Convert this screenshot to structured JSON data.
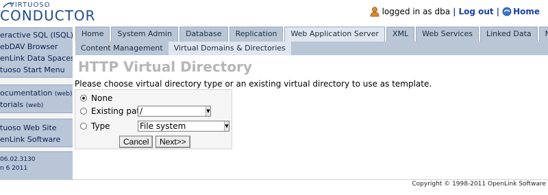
{
  "app": {
    "logo_top": "VIRTUOSO",
    "logo_main": "CONDUCTOR"
  },
  "userbar": {
    "user_icon": "user-icon",
    "logged_in_text": "logged in as dba",
    "separator": "|",
    "logout_label": "Log out",
    "home_icon": "home-icon",
    "home_label": "Home"
  },
  "sidebar": {
    "groups": [
      {
        "items": [
          {
            "text": "eractive SQL (ISQL)"
          },
          {
            "text": "ebDAV Browser"
          },
          {
            "text": "enLink Data Spaces"
          },
          {
            "text": "tuoso Start Menu"
          }
        ]
      },
      {
        "items": [
          {
            "text": "ocumentation",
            "small": "(web)"
          },
          {
            "text": "torials",
            "small": "(web)"
          }
        ]
      },
      {
        "items": [
          {
            "text": "tuoso Web Site"
          },
          {
            "text": "enLink Software"
          }
        ]
      },
      {
        "items": [
          {
            "text": " 06.02.3130"
          },
          {
            "text": "n 6 2011"
          }
        ]
      }
    ]
  },
  "tabs": [
    {
      "label": "Home",
      "active": false
    },
    {
      "label": "System Admin",
      "active": false
    },
    {
      "label": "Database",
      "active": false
    },
    {
      "label": "Replication",
      "active": false
    },
    {
      "label": "Web Application Server",
      "active": true
    },
    {
      "label": "XML",
      "active": false
    },
    {
      "label": "Web Services",
      "active": false
    },
    {
      "label": "Linked Data",
      "active": false
    },
    {
      "label": "NNTP",
      "active": false
    }
  ],
  "subtabs": [
    {
      "label": "Content Management",
      "active": false
    },
    {
      "label": "Virtual Domains & Directories",
      "active": true
    }
  ],
  "page_title": "HTTP Virtual Directory",
  "prompt": "Please choose virtual directory type or an existing virtual directory to use as template.",
  "form": {
    "option_none": "None",
    "option_existing": "Existing path",
    "option_type": "Type",
    "selected": "none",
    "existing_path_value": "/",
    "type_value": "File system",
    "cancel_label": "Cancel",
    "next_label": "Next>>"
  },
  "footer": "Copyright © 1998-2011 OpenLink Software",
  "colors": {
    "brand": "#1e4e8c",
    "link": "#1a3ea8",
    "tab_bg": "#b9c6d6",
    "tab_active_bg": "#dfe6ef",
    "title_gray": "#b6b6b6"
  }
}
